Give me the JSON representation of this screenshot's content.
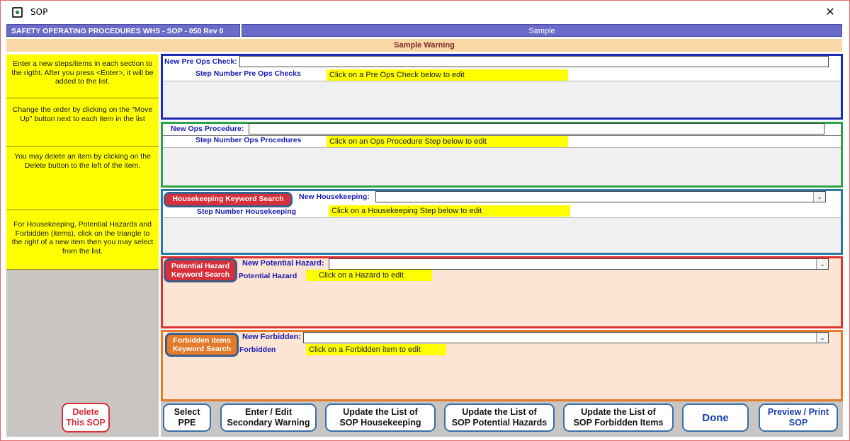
{
  "window": {
    "title": "SOP",
    "close_glyph": "✕"
  },
  "header": {
    "left": "SAFETY OPERATING PROCEDURES  WHS - SOP -  050 Rev  0",
    "right": "Sample",
    "warning": "Sample Warning"
  },
  "help": [
    "Enter a new steps/items in each section to the rigtht.  After you press <Enter>, it will be added to the list.",
    "Change the order by clicking on the \"Move Up\" button next to each item in the list",
    "You may delete an item by clicking on the Delete button to the left of the item.",
    "For Housekeeping, Potential Hazards and Forbidden (items), click on the triangle to the right of a new item then you may select from the list."
  ],
  "preops": {
    "label": "New Pre Ops Check:",
    "value": "",
    "step_label": "Step Number Pre Ops Checks",
    "hint": "Click on a Pre Ops Check below to edit"
  },
  "ops": {
    "label": "New Ops Procedure:",
    "value": "",
    "step_label": "Step Number Ops Procedures",
    "hint": "Click on an Ops Procedure Step below to edit"
  },
  "housekeeping": {
    "keyword_button": "Housekeeping Keyword Search",
    "label": "New Housekeeping:",
    "value": "",
    "step_label": "Step Number Housekeeping",
    "hint": "Click on a Housekeeping Step below to edit"
  },
  "hazard": {
    "keyword_button_line1": "Potential Hazard",
    "keyword_button_line2": "Keyword Search",
    "label": "New Potential Hazard:",
    "value": "",
    "step_label": "Potential Hazard",
    "hint": "Click on a Hazard to edit"
  },
  "forbidden": {
    "keyword_button_line1": "Forbidden items",
    "keyword_button_line2": "Keyword Search",
    "label": "New Forbidden:",
    "value": "",
    "step_label": "Forbidden",
    "hint": "Click on a Forbidden item to edit"
  },
  "buttons": {
    "delete": [
      "Delete",
      "This SOP"
    ],
    "ppe": [
      "Select",
      "PPE"
    ],
    "secondary": [
      "Enter / Edit",
      "Secondary Warning"
    ],
    "housekeeping": [
      "Update the List of",
      "SOP Housekeeping"
    ],
    "hazards": [
      "Update the List of",
      "SOP Potential Hazards"
    ],
    "forbidden": [
      "Update the List of",
      "SOP Forbidden Items"
    ],
    "done": "Done",
    "preview": [
      "Preview / Print",
      "SOP"
    ]
  },
  "combo_arrow_glyph": "⌄",
  "colors": {
    "header_blue": "#6b6bc9",
    "warning_bar": "#f9d8a6",
    "hint_yellow": "#ffff00",
    "preops_border": "#1d2ab7",
    "ops_border": "#2fa34a",
    "house_border": "#2a7aa8",
    "hazard_border": "#e0302f",
    "forbidden_border": "#e47b2a",
    "hazard_fill": "#fce5d4"
  }
}
